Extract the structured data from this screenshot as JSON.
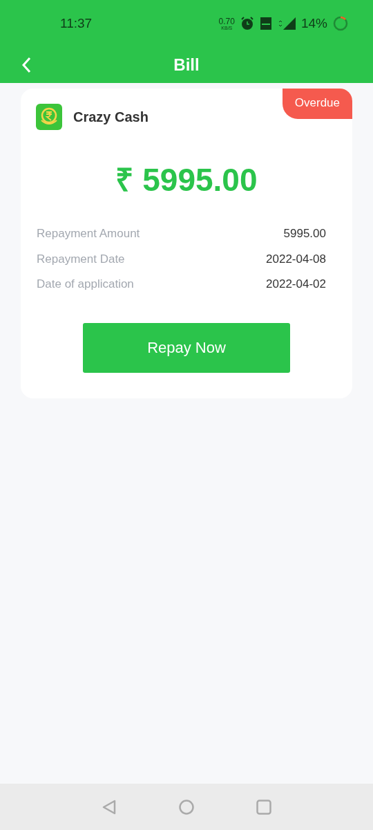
{
  "status_bar": {
    "time": "11:37",
    "speed": "0.70",
    "speed_unit": "KB/S",
    "battery": "14%"
  },
  "header": {
    "title": "Bill"
  },
  "bill": {
    "app_name": "Crazy Cash",
    "status": "Overdue",
    "amount": "₹ 5995.00",
    "details": [
      {
        "label": "Repayment Amount",
        "value": "5995.00"
      },
      {
        "label": "Repayment Date",
        "value": "2022-04-08"
      },
      {
        "label": "Date of application",
        "value": "2022-04-02"
      }
    ],
    "button": "Repay Now"
  }
}
